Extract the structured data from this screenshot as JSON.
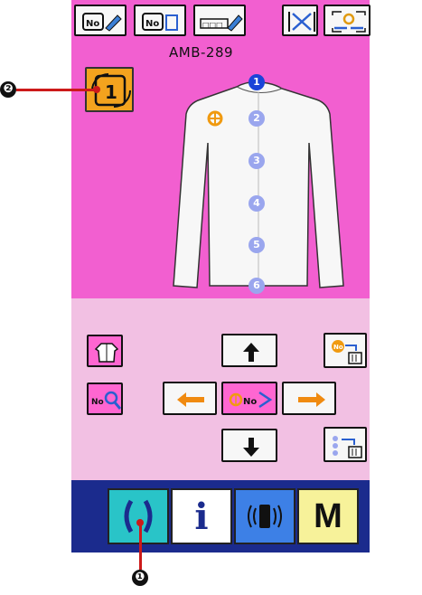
{
  "header": {
    "model_name": "AMB-289"
  },
  "garment": {
    "buttons": [
      {
        "label": "1",
        "selected": true
      },
      {
        "label": "2",
        "selected": false
      },
      {
        "label": "3",
        "selected": false
      },
      {
        "label": "4",
        "selected": false
      },
      {
        "label": "5",
        "selected": false
      },
      {
        "label": "6",
        "selected": false
      }
    ]
  },
  "bottom_bar": {
    "info_label": "i",
    "mode_label": "M"
  },
  "callouts": {
    "one": "❶",
    "two": "❷"
  },
  "colors": {
    "top_panel": "#f25fd0",
    "mid_panel": "#f2c0e3",
    "bottom_bar": "#1b2b8d",
    "selected_dot": "#1a44d8",
    "dot": "#9aa6ee",
    "pattern_select": "#f3a31e"
  }
}
